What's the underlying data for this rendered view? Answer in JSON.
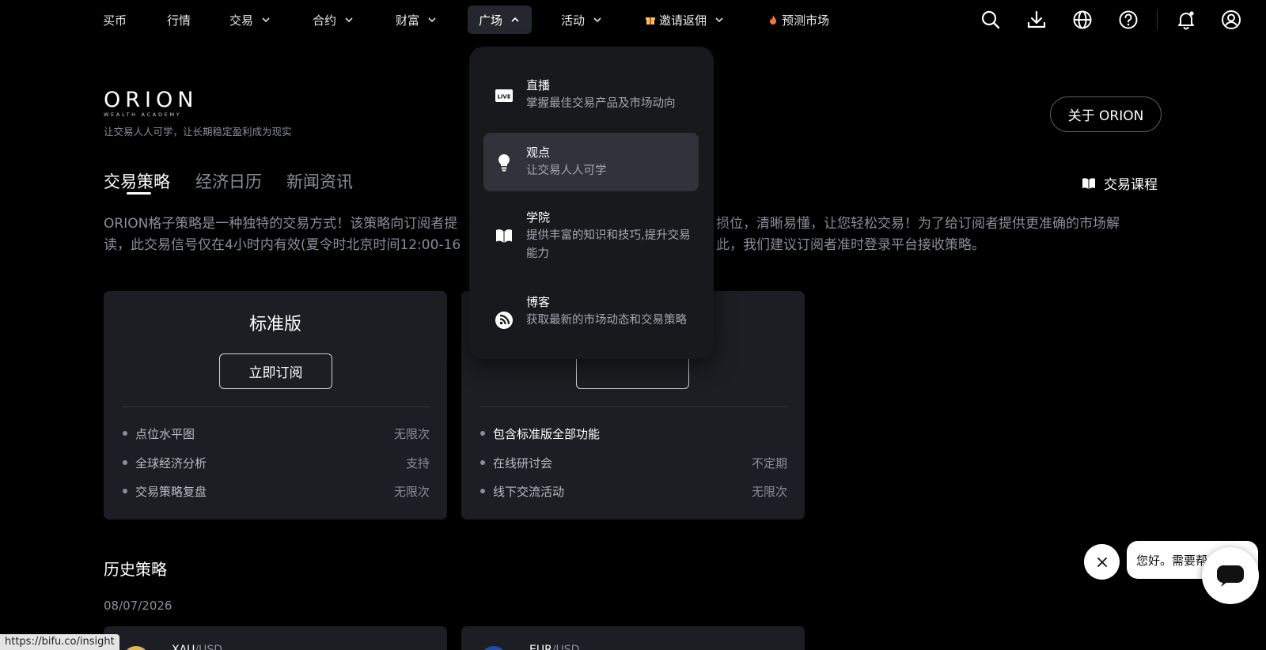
{
  "nav": {
    "items": [
      {
        "label": "买币"
      },
      {
        "label": "行情"
      },
      {
        "label": "交易"
      },
      {
        "label": "合约"
      },
      {
        "label": "财富"
      },
      {
        "label": "广场"
      },
      {
        "label": "活动"
      },
      {
        "label": "邀请返佣"
      },
      {
        "label": "预测市场"
      }
    ],
    "active": "广场",
    "icons": [
      "search-icon",
      "download-icon",
      "globe-icon",
      "help-icon",
      "bell-icon",
      "user-icon"
    ]
  },
  "dropdown": {
    "items": [
      {
        "title": "直播",
        "desc": "掌握最佳交易产品及市场动向",
        "icon": "live-icon"
      },
      {
        "title": "观点",
        "desc": "让交易人人可学",
        "icon": "lightbulb-icon"
      },
      {
        "title": "学院",
        "desc": "提供丰富的知识和技巧,提升交易能力",
        "icon": "book-icon"
      },
      {
        "title": "博客",
        "desc": "获取最新的市场动态和交易策略",
        "icon": "blog-icon"
      }
    ]
  },
  "brand": {
    "logo": "ORION",
    "logo_sub": "WEALTH ACADEMY",
    "tagline": "让交易人人可学，让长期稳定盈利成为现实",
    "about_label": "关于 ORION"
  },
  "tabs": {
    "items": [
      {
        "label": "交易策略"
      },
      {
        "label": "经济日历"
      },
      {
        "label": "新闻资讯"
      }
    ],
    "active": "交易策略",
    "course_label": "交易课程"
  },
  "description": {
    "line1": "ORION格子策略是一种独特的交易方式！该策略向订阅者提",
    "line1b": "损位，清晰易懂，让您轻松交易！为了给订阅者提供更准确的市场解",
    "line2": "读，此交易信号仅在4小时内有效(夏令时北京时间12:00-16",
    "line2b": "此，我们建议订阅者准时登录平台接收策略。"
  },
  "plans": [
    {
      "title": "标准版",
      "button": "立即订阅",
      "features": [
        {
          "label": "点位水平图",
          "value": "无限次"
        },
        {
          "label": "全球经济分析",
          "value": "支持"
        },
        {
          "label": "交易策略复盘",
          "value": "无限次"
        }
      ]
    },
    {
      "title": "",
      "button": "",
      "features": [
        {
          "label": "包含标准版全部功能",
          "value": ""
        },
        {
          "label": "在线研讨会",
          "value": "不定期"
        },
        {
          "label": "线下交流活动",
          "value": "无限次"
        }
      ]
    }
  ],
  "history": {
    "title": "历史策略",
    "date": "08/07/2026",
    "cards": [
      {
        "base": "XAU",
        "quote": "/USD",
        "color": "#e6b64e"
      },
      {
        "base": "EUR",
        "quote": "/USD",
        "color": "#1c4fb3"
      }
    ]
  },
  "chat": {
    "greeting": "您好。需要帮"
  },
  "status_url": "https://bifu.co/insight"
}
